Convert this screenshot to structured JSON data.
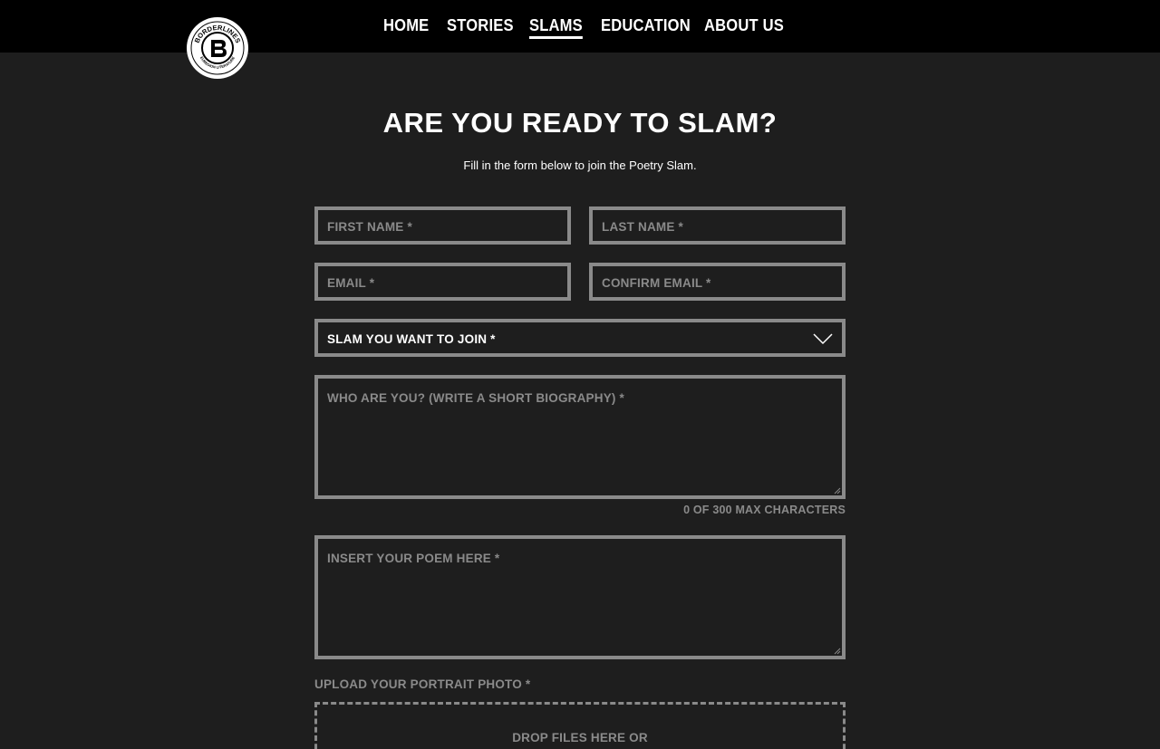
{
  "header": {
    "logo_text": "BORDERLINES",
    "logo_subtext": "EUREGION LITERATURE",
    "logo_letter": "B",
    "nav": [
      {
        "label": "HOME",
        "active": false
      },
      {
        "label": "STORIES",
        "active": false
      },
      {
        "label": "SLAMS",
        "active": true
      },
      {
        "label": "EDUCATION",
        "active": false
      },
      {
        "label": "ABOUT US",
        "active": false
      }
    ]
  },
  "form": {
    "title": "ARE YOU READY TO SLAM?",
    "subtitle": "Fill in the form below to join the Poetry Slam.",
    "first_name_placeholder": "FIRST NAME *",
    "last_name_placeholder": "LAST NAME *",
    "email_placeholder": "EMAIL *",
    "confirm_email_placeholder": "CONFIRM EMAIL *",
    "slam_select_label": "SLAM YOU WANT TO JOIN *",
    "bio_placeholder": "WHO ARE YOU? (WRITE A SHORT BIOGRAPHY) *",
    "bio_counter": "0 OF 300 MAX CHARACTERS",
    "poem_placeholder": "INSERT YOUR POEM HERE *",
    "upload_label": "UPLOAD YOUR PORTRAIT PHOTO *",
    "dropzone_text": "DROP FILES HERE OR"
  },
  "colors": {
    "background": "#1e1e1e",
    "header": "#000000",
    "border": "#8a8a8a",
    "text": "#ffffff"
  }
}
